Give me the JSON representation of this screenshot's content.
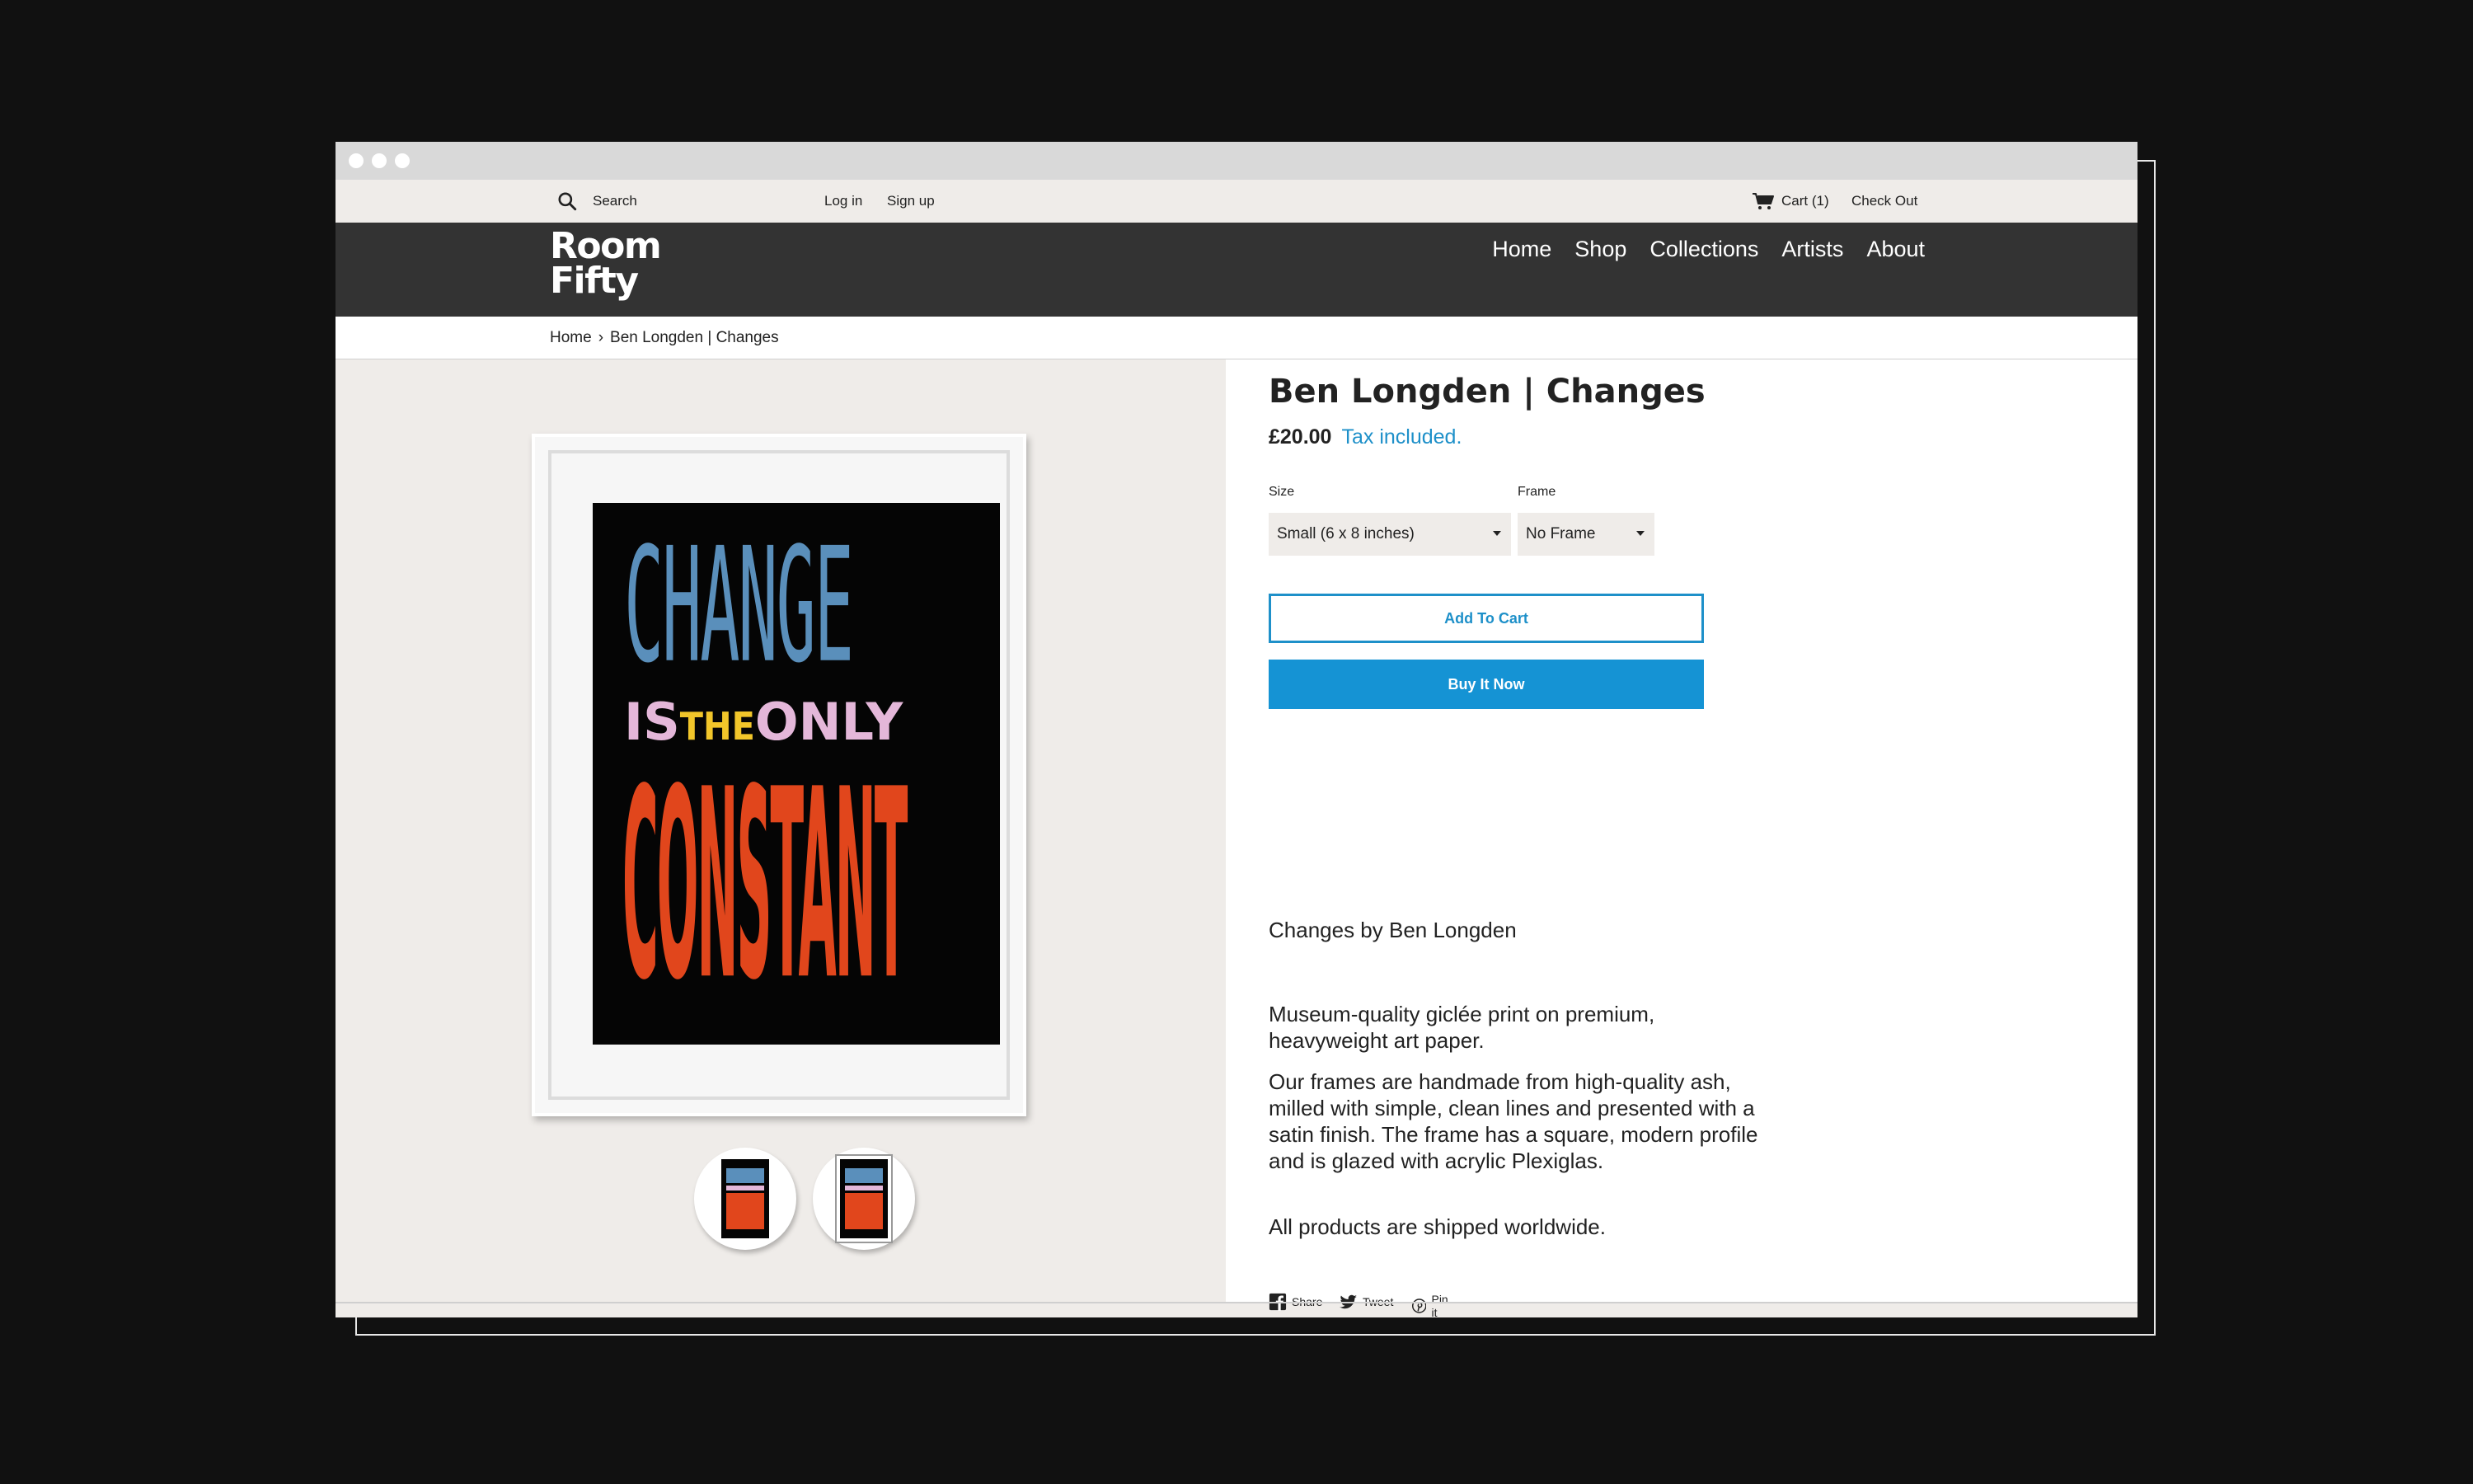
{
  "topbar": {
    "search_placeholder": "Search",
    "login": "Log in",
    "signup": "Sign up",
    "cart": "Cart (1)",
    "checkout": "Check Out"
  },
  "header": {
    "logo_line1": "Room",
    "logo_line2": "Fifty",
    "nav": [
      "Home",
      "Shop",
      "Collections",
      "Artists",
      "About"
    ]
  },
  "breadcrumb": {
    "home": "Home",
    "separator": "›",
    "current": "Ben Longden | Changes"
  },
  "poster": {
    "line1": "CHANGE",
    "is": "IS",
    "the": "THE",
    "only": "ONLY",
    "line3": "CONSTANT"
  },
  "product": {
    "title": "Ben Longden | Changes",
    "price": "£20.00",
    "tax_note": "Tax included.",
    "size_label": "Size",
    "size_value": "Small (6 x 8 inches)",
    "frame_label": "Frame",
    "frame_value": "No Frame",
    "add_to_cart": "Add To Cart",
    "buy_now": "Buy It Now",
    "description": [
      "Changes by Ben Longden",
      "Museum-quality giclée print on premium, heavyweight art paper.",
      "Our frames are handmade from high-quality ash, milled with simple, clean lines and presented with a satin finish. The frame has a square, modern profile and is glazed with acrylic Plexiglas.",
      "All products are shipped worldwide."
    ]
  },
  "share": {
    "facebook": "Share",
    "twitter": "Tweet",
    "pinterest": "Pin it"
  },
  "colors": {
    "background": "#111111",
    "header": "#333333",
    "accent": "#1e90c9",
    "panel": "#efece9"
  }
}
